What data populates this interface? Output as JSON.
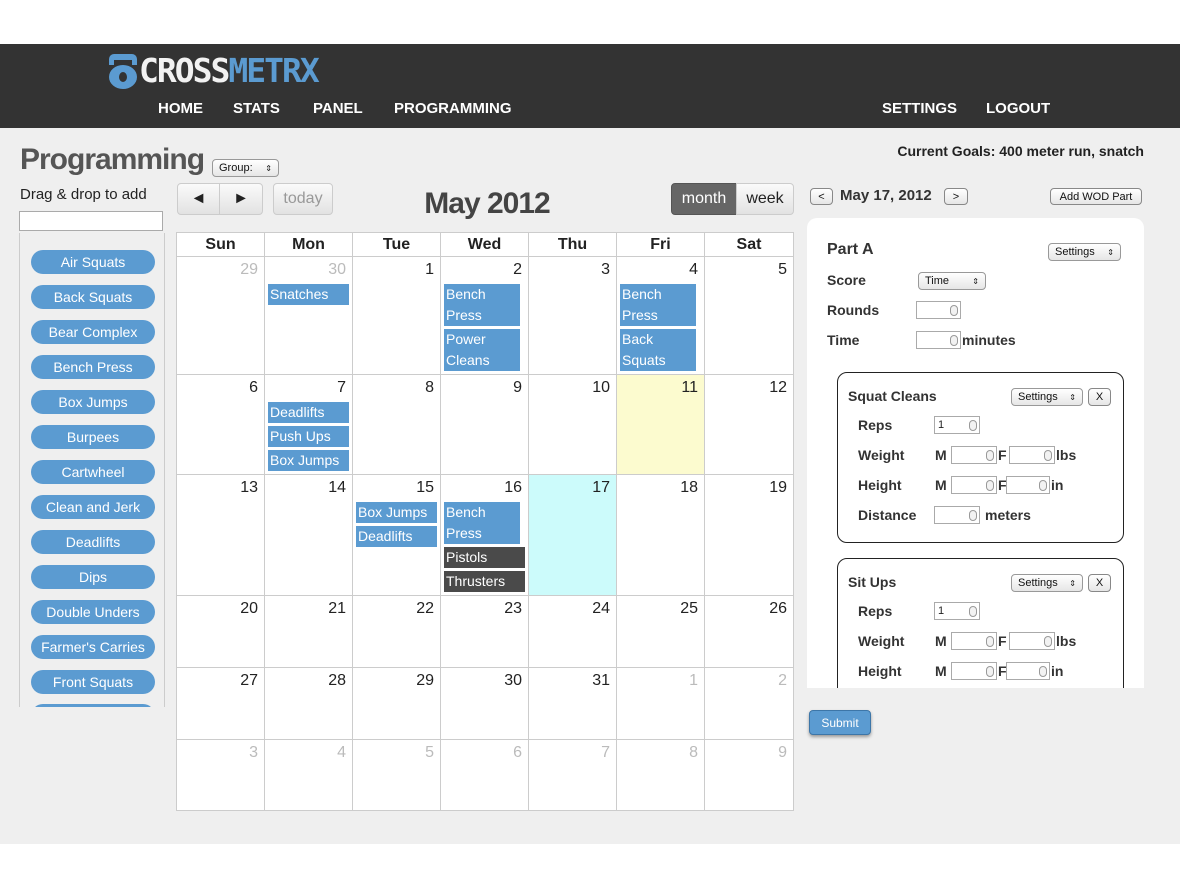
{
  "app": {
    "logo_a": "CROSS",
    "logo_b": "METRX"
  },
  "nav": {
    "home": "HOME",
    "stats": "STATS",
    "panel": "PANEL",
    "programming": "PROGRAMMING",
    "settings": "SETTINGS",
    "logout": "LOGOUT"
  },
  "page": {
    "title": "Programming",
    "group_select": "Group:",
    "goals": "Current Goals: 400 meter run, snatch",
    "drag_label": "Drag & drop to add"
  },
  "exercises": [
    "Air Squats",
    "Back Squats",
    "Bear Complex",
    "Bench Press",
    "Box Jumps",
    "Burpees",
    "Cartwheel",
    "Clean and Jerk",
    "Deadlifts",
    "Dips",
    "Double Unders",
    "Farmer's Carries",
    "Front Squats"
  ],
  "calendar": {
    "title": "May 2012",
    "prev": "◄",
    "next": "►",
    "today_btn": "today",
    "month_btn": "month",
    "week_btn": "week",
    "days": [
      "Sun",
      "Mon",
      "Tue",
      "Wed",
      "Thu",
      "Fri",
      "Sat"
    ],
    "weeks": [
      [
        "29",
        "30",
        "1",
        "2",
        "3",
        "4",
        "5"
      ],
      [
        "6",
        "7",
        "8",
        "9",
        "10",
        "11",
        "12"
      ],
      [
        "13",
        "14",
        "15",
        "16",
        "17",
        "18",
        "19"
      ],
      [
        "20",
        "21",
        "22",
        "23",
        "24",
        "25",
        "26"
      ],
      [
        "27",
        "28",
        "29",
        "30",
        "31",
        "1",
        "2"
      ],
      [
        "3",
        "4",
        "5",
        "6",
        "7",
        "8",
        "9"
      ]
    ],
    "events": {
      "w0_mon": "Snatches",
      "w0_wed_1": "Bench Press",
      "w0_wed_2": "Power Cleans",
      "w0_fri_1": "Bench Press",
      "w0_fri_2": "Back Squats",
      "w1_mon_1": "Deadlifts",
      "w1_mon_2": "Push Ups",
      "w1_mon_3": "Box Jumps",
      "w2_tue_1": "Box Jumps",
      "w2_tue_2": "Deadlifts",
      "w2_wed_1": "Bench Press",
      "w2_wed_2": "Pistols",
      "w2_wed_3": "Thrusters"
    }
  },
  "panel": {
    "prev": "<",
    "next": ">",
    "date": "May 17, 2012",
    "add_btn": "Add WOD Part",
    "part_title": "Part A",
    "settings": "Settings",
    "score_label": "Score",
    "score_value": "Time",
    "rounds_label": "Rounds",
    "time_label": "Time",
    "minutes": "minutes",
    "card1": {
      "title": "Squat Cleans",
      "settings": "Settings",
      "close": "X",
      "reps": "Reps",
      "reps_value": "1",
      "weight": "Weight",
      "height": "Height",
      "distance": "Distance",
      "m": "M",
      "f": "F",
      "lbs": "lbs",
      "in": "in",
      "meters": "meters"
    },
    "card2": {
      "title": "Sit Ups",
      "settings": "Settings",
      "close": "X",
      "reps": "Reps",
      "reps_value": "1",
      "weight": "Weight",
      "height": "Height",
      "m": "M",
      "f": "F",
      "lbs": "lbs",
      "in": "in"
    },
    "submit": "Submit"
  }
}
